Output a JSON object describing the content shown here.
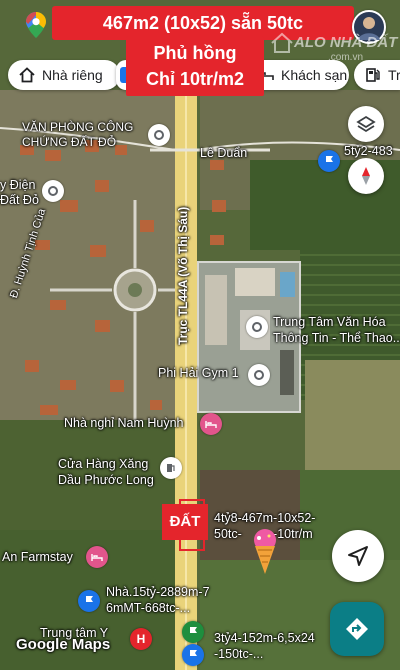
{
  "search": {
    "title": "467m2 (10x52) sẵn 50tc"
  },
  "watermark": {
    "text": "ALO NHÀ ĐẤT",
    "sub": ".com.vn"
  },
  "overlay": {
    "line1": "Phủ hồng",
    "line2": "Chỉ 10tr/m2"
  },
  "chips": [
    {
      "label": "Nhà riêng",
      "icon": "home-icon"
    },
    {
      "label": "Khách sạn",
      "icon": "bed-icon"
    },
    {
      "label": "Trạ",
      "icon": "gas-station-icon"
    }
  ],
  "road": {
    "label": "Trục TL44A (Võ Thị Sáu)"
  },
  "places": {
    "notary": "VĂN PHÒNG CÔNG\nCHỨNG ĐẤT ĐỎ",
    "le_duan": "Lê Duẩn",
    "power": "y Điện\nĐất Đỏ",
    "huynh_tinh_cua": "Đ. Huỳnh Tịnh Của",
    "culture_center": "Trung Tâm Văn Hóa\nThông Tin - Thể Thao...",
    "gym": "Phi Hải Gym 1",
    "guesthouse": "Nhà nghỉ Nam Huỳnh",
    "gas_station": "Cửa Hàng Xăng\nDầu Phước Long",
    "farmstay": "An Farmstay",
    "center": "Trung tâm Y",
    "top_right_listing": "5tỷ2-483",
    "listing_1": "4tỷ8-467m-10x52-\n50tc-         -10tr/m",
    "listing_2": "Nhà.15tỷ-2889m-7\n6mMT-668tc-...",
    "listing_3": "3tỷ4-152m-6,5x24\n-150tc-..."
  },
  "land_marker": {
    "label": "ĐẤT"
  },
  "attribution": "Google Maps",
  "colors": {
    "accent_red": "#e4252c",
    "maps_blue": "#1a73e8",
    "maps_teal": "#0b7e86"
  }
}
